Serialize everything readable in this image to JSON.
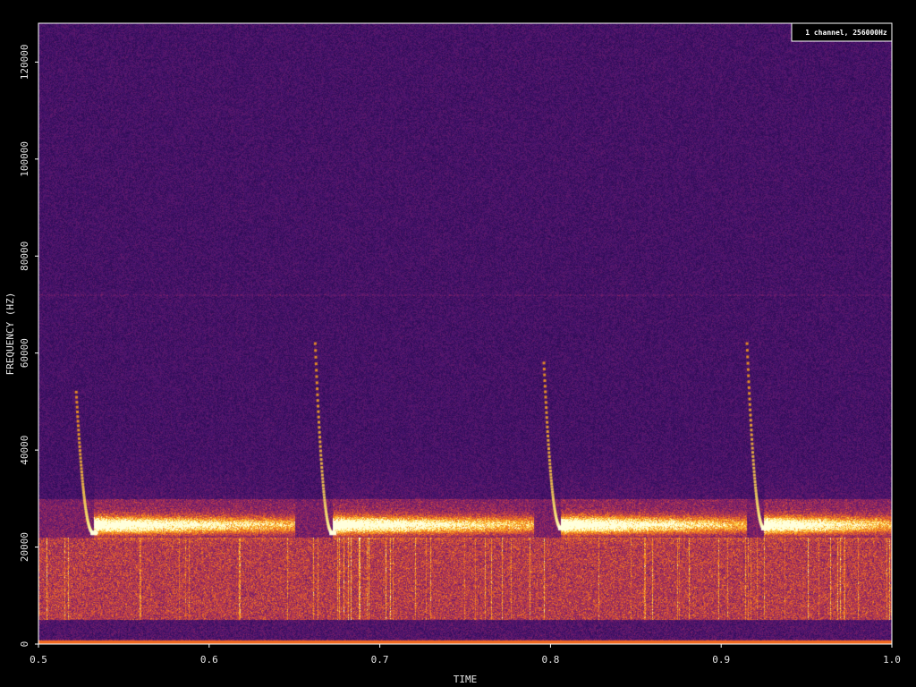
{
  "chart_data": {
    "type": "heatmap",
    "title": "",
    "info_label": "1 channel, 256000Hz",
    "xlabel": "TIME",
    "ylabel": "FREQUENCY (HZ)",
    "xlim": [
      0.5,
      1.0
    ],
    "ylim": [
      0,
      128000
    ],
    "x_ticks": [
      {
        "value": 0.5,
        "label": "0.5"
      },
      {
        "value": 0.6,
        "label": "0.6"
      },
      {
        "value": 0.7,
        "label": "0.7"
      },
      {
        "value": 0.8,
        "label": "0.8"
      },
      {
        "value": 0.9,
        "label": "0.9"
      },
      {
        "value": 1.0,
        "label": "1.0"
      }
    ],
    "y_ticks": [
      {
        "value": 0,
        "label": "0"
      },
      {
        "value": 20000,
        "label": "20000"
      },
      {
        "value": 40000,
        "label": "40000"
      },
      {
        "value": 60000,
        "label": "60000"
      },
      {
        "value": 80000,
        "label": "80000"
      },
      {
        "value": 100000,
        "label": "100000"
      },
      {
        "value": 120000,
        "label": "120000"
      }
    ],
    "grid": false,
    "colormap": "inferno",
    "calls": [
      {
        "start_time": 0.522,
        "end_time": 0.532,
        "start_freq": 52000,
        "end_freq": 23000,
        "tail_end_time": 0.65
      },
      {
        "start_time": 0.662,
        "end_time": 0.672,
        "start_freq": 62000,
        "end_freq": 23000,
        "tail_end_time": 0.79
      },
      {
        "start_time": 0.796,
        "end_time": 0.806,
        "start_freq": 58000,
        "end_freq": 24000,
        "tail_end_time": 0.915
      },
      {
        "start_time": 0.915,
        "end_time": 0.925,
        "start_freq": 62000,
        "end_freq": 24000,
        "tail_end_time": 1.0
      }
    ],
    "tonal_band_freq": 72000,
    "colors": {
      "background": "#000000",
      "noise_low": "#3a1264",
      "noise_high": "#5a2078",
      "band_mid": "#9a2f6a",
      "band_hot": "#f57d15",
      "peak": "#fff3a0",
      "baseline": "#f06a20",
      "frame": "#ffffff"
    }
  }
}
